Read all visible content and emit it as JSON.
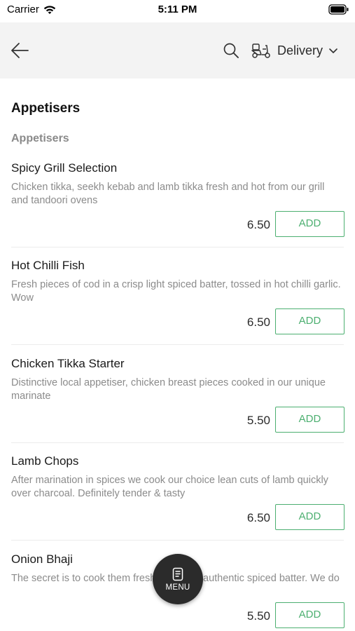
{
  "status_bar": {
    "carrier": "Carrier",
    "time": "5:11 PM"
  },
  "header": {
    "back_icon": "arrow-left-icon",
    "search_icon": "search-icon",
    "delivery_icon": "delivery-scooter-icon",
    "delivery_label": "Delivery",
    "dropdown_icon": "chevron-down-icon"
  },
  "section": {
    "title": "Appetisers",
    "subtitle": "Appetisers"
  },
  "items": [
    {
      "name": "Spicy Grill Selection",
      "description": "Chicken tikka, seekh kebab and lamb tikka fresh and hot from our grill and tandoori ovens",
      "price": "6.50",
      "add_label": "ADD"
    },
    {
      "name": "Hot Chilli Fish",
      "description": "Fresh pieces of cod in a crisp light spiced batter, tossed in hot chilli garlic. Wow",
      "price": "6.50",
      "add_label": "ADD"
    },
    {
      "name": "Chicken Tikka Starter",
      "description": "Distinctive local appetiser, chicken breast pieces cooked in our unique marinate",
      "price": "5.50",
      "add_label": "ADD"
    },
    {
      "name": "Lamb Chops",
      "description": "After marination in spices we cook our choice lean cuts of lamb quickly over charcoal. Definitely tender & tasty",
      "price": "6.50",
      "add_label": "ADD"
    },
    {
      "name": "Onion Bhaji",
      "description": "The secret is to cook them fresh and fry in authentic spiced batter. We do",
      "price": "5.50",
      "add_label": "ADD"
    }
  ],
  "menu_button": {
    "icon": "menu-card-icon",
    "label": "MENU"
  },
  "colors": {
    "accent_green": "#4caf70",
    "header_bg": "#f3f3f3",
    "fab_bg": "#2b2b2b"
  }
}
